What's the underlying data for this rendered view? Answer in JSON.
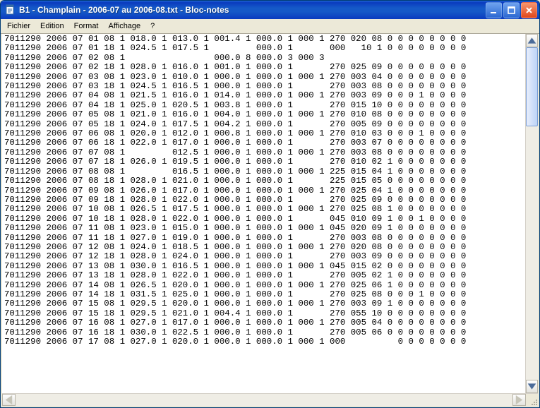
{
  "window": {
    "title": "B1 - Champlain - 2006-07 au 2006-08.txt - Bloc-notes"
  },
  "menu": {
    "file": "Fichier",
    "edit": "Edition",
    "format": "Format",
    "view": "Affichage",
    "help": "?"
  },
  "text_lines": [
    "7011290 2006 07 01 08 1 018.0 1 013.0 1 001.4 1 000.0 1 000 1 270 020 08 0 0 0 0 0 0 0 0",
    "7011290 2006 07 01 18 1 024.5 1 017.5 1         000.0 1       000   10 1 0 0 0 0 0 0 0 0",
    "7011290 2006 07 02 08 1                 000.0 8 000.0 3 000 3",
    "7011290 2006 07 02 18 1 028.0 1 016.0 1 001.0 1 000.0 1       270 025 09 0 0 0 0 0 0 0 0",
    "7011290 2006 07 03 08 1 023.0 1 010.0 1 000.0 1 000.0 1 000 1 270 003 04 0 0 0 0 0 0 0 0",
    "7011290 2006 07 03 18 1 024.5 1 016.5 1 000.0 1 000.0 1       270 003 08 0 0 0 0 0 0 0 0",
    "7011290 2006 07 04 08 1 021.5 1 016.0 1 014.0 1 000.0 1 000 1 270 003 09 0 0 0 1 0 0 0 0",
    "7011290 2006 07 04 18 1 025.0 1 020.5 1 003.8 1 000.0 1       270 015 10 0 0 0 0 0 0 0 0",
    "7011290 2006 07 05 08 1 021.0 1 016.0 1 004.0 1 000.0 1 000 1 270 010 08 0 0 0 0 0 0 0 0",
    "7011290 2006 07 05 18 1 024.0 1 017.5 1 004.2 1 000.0 1       270 005 09 0 0 0 0 0 0 0 0",
    "7011290 2006 07 06 08 1 020.0 1 012.0 1 000.8 1 000.0 1 000 1 270 010 03 0 0 0 1 0 0 0 0",
    "7011290 2006 07 06 18 1 022.0 1 017.0 1 000.0 1 000.0 1       270 003 07 0 0 0 0 0 0 0 0",
    "7011290 2006 07 07 08 1         012.5 1 000.0 1 000.0 1 000 1 270 003 08 0 0 0 0 0 0 0 0",
    "7011290 2006 07 07 18 1 026.0 1 019.5 1 000.0 1 000.0 1       270 010 02 1 0 0 0 0 0 0 0",
    "7011290 2006 07 08 08 1         016.5 1 000.0 1 000.0 1 000 1 225 015 04 1 0 0 0 0 0 0 0",
    "7011290 2006 07 08 18 1 028.0 1 021.0 1 000.0 1 000.0 1       225 015 05 0 0 0 0 0 0 0 0",
    "7011290 2006 07 09 08 1 026.0 1 017.0 1 000.0 1 000.0 1 000 1 270 025 04 1 0 0 0 0 0 0 0",
    "7011290 2006 07 09 18 1 028.0 1 022.0 1 000.0 1 000.0 1       270 025 09 0 0 0 0 0 0 0 0",
    "7011290 2006 07 10 08 1 026.5 1 017.5 1 000.0 1 000.0 1 000 1 270 025 08 1 0 0 0 0 0 0 0",
    "7011290 2006 07 10 18 1 028.0 1 022.0 1 000.0 1 000.0 1       045 010 09 1 0 0 1 0 0 0 0",
    "7011290 2006 07 11 08 1 023.0 1 015.0 1 000.0 1 000.0 1 000 1 045 020 09 1 0 0 0 0 0 0 0",
    "7011290 2006 07 11 18 1 027.0 1 019.0 1 000.0 1 000.0 1       270 003 08 0 0 0 0 0 0 0 0",
    "7011290 2006 07 12 08 1 024.0 1 018.5 1 000.0 1 000.0 1 000 1 270 020 08 0 0 0 0 0 0 0 0",
    "7011290 2006 07 12 18 1 028.0 1 024.0 1 000.0 1 000.0 1       270 003 09 0 0 0 0 0 0 0 0",
    "7011290 2006 07 13 08 1 030.0 1 016.5 1 000.0 1 000.0 1 000 1 045 015 02 0 0 0 0 0 0 0 0",
    "7011290 2006 07 13 18 1 028.0 1 022.0 1 000.0 1 000.0 1       270 005 02 1 0 0 0 0 0 0 0",
    "7011290 2006 07 14 08 1 026.5 1 020.0 1 000.0 1 000.0 1 000 1 270 025 06 1 0 0 0 0 0 0 0",
    "7011290 2006 07 14 18 1 031.5 1 025.0 1 000.0 1 000.0 1       270 025 08 0 0 0 1 0 0 0 0",
    "7011290 2006 07 15 08 1 029.5 1 020.0 1 000.0 1 000.0 1 000 1 270 003 09 1 0 0 0 0 0 0 0",
    "7011290 2006 07 15 18 1 029.5 1 021.0 1 004.4 1 000.0 1       270 055 10 0 0 0 0 0 0 0 0",
    "7011290 2006 07 16 08 1 027.0 1 017.0 1 000.0 1 000.0 1 000 1 270 005 04 0 0 0 0 0 0 0 0",
    "7011290 2006 07 16 18 1 030.0 1 022.5 1 000.0 1 000.0 1       270 005 06 0 0 0 0 0 0 0 0",
    "7011290 2006 07 17 08 1 027.0 1 020.0 1 000.0 1 000.0 1 000 1 000          0 0 0 0 0 0 0"
  ]
}
